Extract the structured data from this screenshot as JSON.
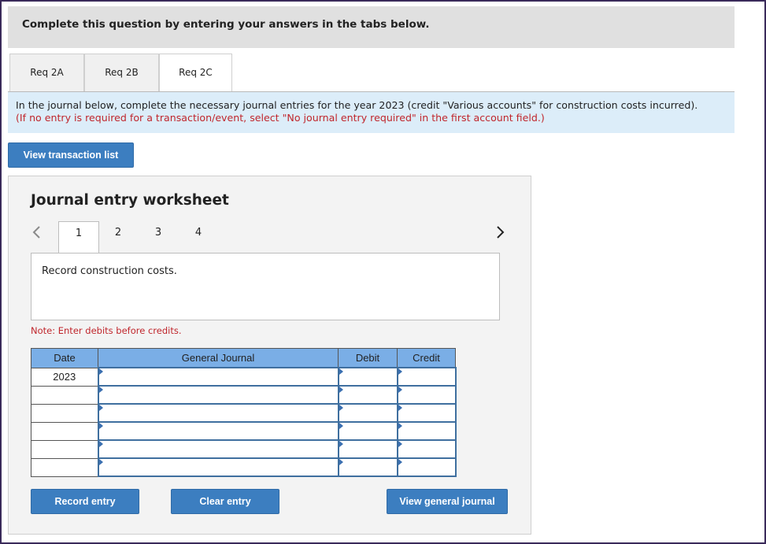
{
  "banner": {
    "text": "Complete this question by entering your answers in the tabs below."
  },
  "tabs": [
    {
      "label": "Req 2A",
      "active": false
    },
    {
      "label": "Req 2B",
      "active": false
    },
    {
      "label": "Req 2C",
      "active": true
    }
  ],
  "instructions": {
    "line1": "In the journal below, complete the necessary journal entries for the year 2023 (credit \"Various accounts\" for construction costs incurred).",
    "line2": "(If no entry is required for a transaction/event, select \"No journal entry required\" in the first account field.)"
  },
  "buttons": {
    "view_transaction_list": "View transaction list",
    "record_entry": "Record entry",
    "clear_entry": "Clear entry",
    "view_general_journal": "View general journal"
  },
  "worksheet": {
    "title": "Journal entry worksheet",
    "pages": [
      "1",
      "2",
      "3",
      "4"
    ],
    "active_page": "1",
    "description": "Record construction costs.",
    "note": "Note: Enter debits before credits."
  },
  "journal_table": {
    "headers": {
      "date": "Date",
      "general_journal": "General Journal",
      "debit": "Debit",
      "credit": "Credit"
    },
    "rows": [
      {
        "date": "2023",
        "account": "",
        "debit": "",
        "credit": ""
      },
      {
        "date": "",
        "account": "",
        "debit": "",
        "credit": ""
      },
      {
        "date": "",
        "account": "",
        "debit": "",
        "credit": ""
      },
      {
        "date": "",
        "account": "",
        "debit": "",
        "credit": ""
      },
      {
        "date": "",
        "account": "",
        "debit": "",
        "credit": ""
      },
      {
        "date": "",
        "account": "",
        "debit": "",
        "credit": ""
      }
    ]
  },
  "colors": {
    "accent": "#3c7ec0",
    "instruction_bg": "#dcedf9",
    "warning_text": "#c0262c",
    "table_header": "#7aaee6"
  },
  "icons": {
    "prev": "chevron-left-icon",
    "next": "chevron-right-icon"
  }
}
